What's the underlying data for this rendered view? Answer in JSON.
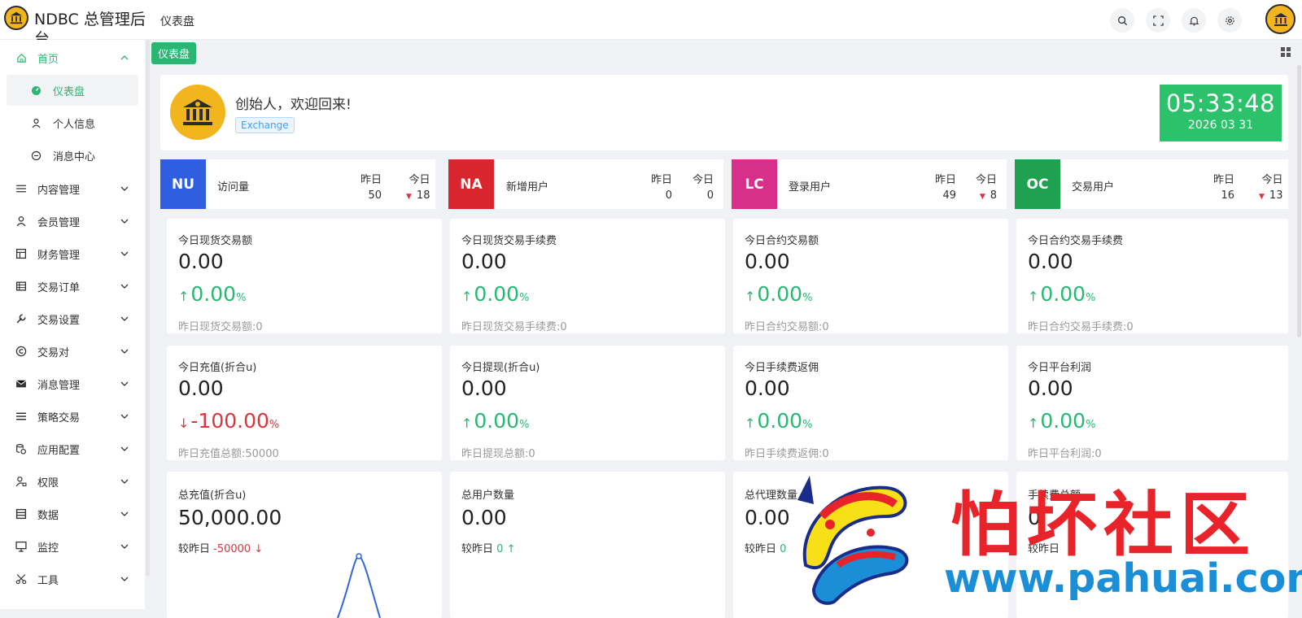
{
  "app": {
    "title": "NDBC 总管理后台",
    "crumb": "仪表盘"
  },
  "tag": {
    "label": "仪表盘"
  },
  "sidebar": {
    "items": [
      {
        "label": "首页",
        "icon": "home-icon",
        "expanded": true
      },
      {
        "label": "内容管理",
        "icon": "list-icon"
      },
      {
        "label": "会员管理",
        "icon": "user-icon"
      },
      {
        "label": "财务管理",
        "icon": "finance-icon"
      },
      {
        "label": "交易订单",
        "icon": "order-icon"
      },
      {
        "label": "交易设置",
        "icon": "wrench-icon"
      },
      {
        "label": "交易对",
        "icon": "copyright-icon"
      },
      {
        "label": "消息管理",
        "icon": "message-icon"
      },
      {
        "label": "策略交易",
        "icon": "menu-icon"
      },
      {
        "label": "应用配置",
        "icon": "coins-icon"
      },
      {
        "label": "权限",
        "icon": "user-lock-icon"
      },
      {
        "label": "数据",
        "icon": "data-icon"
      },
      {
        "label": "监控",
        "icon": "monitor-icon"
      },
      {
        "label": "工具",
        "icon": "scissors-icon"
      }
    ],
    "sub": [
      {
        "label": "仪表盘",
        "icon": "dashboard-icon",
        "active": true
      },
      {
        "label": "个人信息",
        "icon": "user-icon"
      },
      {
        "label": "消息中心",
        "icon": "chat-icon"
      }
    ]
  },
  "welcome": {
    "greeting": "创始人，欢迎回来!",
    "badge": "Exchange"
  },
  "clock": {
    "time": "05:33:48",
    "date": "2026 03 31"
  },
  "stats": [
    {
      "code": "NU",
      "label": "访问量",
      "yesterday_label": "昨日",
      "today_label": "今日",
      "yesterday": "50",
      "today": "18",
      "color": "#2f5fe0"
    },
    {
      "code": "NA",
      "label": "新增用户",
      "yesterday_label": "昨日",
      "today_label": "今日",
      "yesterday": "0",
      "today": "0",
      "color": "#d9262e"
    },
    {
      "code": "LC",
      "label": "登录用户",
      "yesterday_label": "昨日",
      "today_label": "今日",
      "yesterday": "49",
      "today": "8",
      "color": "#d82f8a"
    },
    {
      "code": "OC",
      "label": "交易用户",
      "yesterday_label": "昨日",
      "today_label": "今日",
      "yesterday": "16",
      "today": "13",
      "color": "#1ea150"
    }
  ],
  "cards_row1": [
    {
      "title": "今日现货交易额",
      "value": "0.00",
      "pct": "0.00",
      "unit": "%",
      "dir": "up",
      "foot": "昨日现货交易额:0"
    },
    {
      "title": "今日现货交易手续费",
      "value": "0.00",
      "pct": "0.00",
      "unit": "%",
      "dir": "up",
      "foot": "昨日现货交易手续费:0"
    },
    {
      "title": "今日合约交易额",
      "value": "0.00",
      "pct": "0.00",
      "unit": "%",
      "dir": "up",
      "foot": "昨日合约交易额:0"
    },
    {
      "title": "今日合约交易手续费",
      "value": "0.00",
      "pct": "0.00",
      "unit": "%",
      "dir": "up",
      "foot": "昨日合约交易手续费:0"
    }
  ],
  "cards_row2": [
    {
      "title": "今日充值(折合u)",
      "value": "0.00",
      "pct": "-100.00",
      "unit": "%",
      "dir": "down",
      "foot": "昨日充值总额:50000"
    },
    {
      "title": "今日提现(折合u)",
      "value": "0.00",
      "pct": "0.00",
      "unit": "%",
      "dir": "up",
      "foot": "昨日提现总额:0"
    },
    {
      "title": "今日手续费返佣",
      "value": "0.00",
      "pct": "0.00",
      "unit": "%",
      "dir": "up",
      "foot": "昨日手续费返佣:0"
    },
    {
      "title": "今日平台利润",
      "value": "0.00",
      "pct": "0.00",
      "unit": "%",
      "dir": "up",
      "foot": "昨日平台利润:0"
    }
  ],
  "cards_row3": [
    {
      "title": "总充值(折合u)",
      "value": "50,000.00",
      "compare_label": "较昨日",
      "compare": "-50000",
      "dir": "down"
    },
    {
      "title": "总用户数量",
      "value": "0.00",
      "compare_label": "较昨日",
      "compare": "0",
      "dir": "up"
    },
    {
      "title": "总代理数量",
      "value": "0.00",
      "compare_label": "较昨日",
      "compare": "0",
      "dir": "up"
    },
    {
      "title": "手续费总额",
      "value": "0",
      "compare_label": "较昨日",
      "compare": "",
      "dir": "up"
    }
  ],
  "watermark": {
    "text": "怕坏社区",
    "url": "www.pahuai.com"
  },
  "colors": {
    "accent": "#2bb673",
    "up": "#2bb673",
    "down": "#d9363e"
  }
}
